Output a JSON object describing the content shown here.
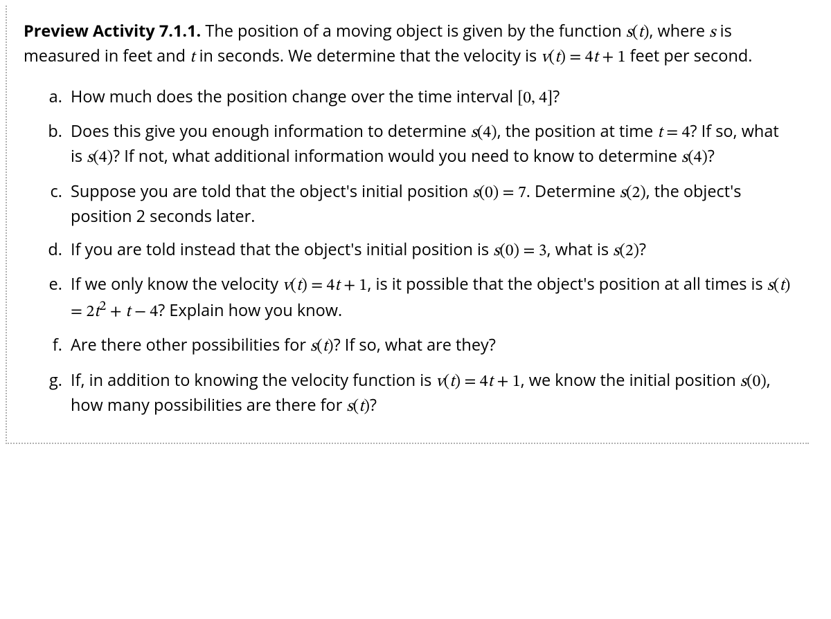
{
  "title": "Preview Activity 7.1.1.",
  "intro_parts": {
    "p1": "The position of a moving object is given by the function ",
    "m1": "s(t)",
    "p2": ", where ",
    "m2": "s",
    "p3": " is measured in feet and ",
    "m3": "t",
    "p4": " in seconds. We determine that the velocity is ",
    "m4": "v(t) = 4t + 1",
    "p5": " feet per second."
  },
  "items": {
    "a": {
      "p1": "How much does the position change over the time interval ",
      "m1": "[0, 4]",
      "p2": "?"
    },
    "b": {
      "p1": "Does this give you enough information to determine ",
      "m1": "s(4)",
      "p2": ", the position at time ",
      "m2": "t = 4",
      "p3": "? If so, what is ",
      "m3": "s(4)",
      "p4": "? If not, what additional information would you need to know to determine ",
      "m4": "s(4)",
      "p5": "?"
    },
    "c": {
      "p1": "Suppose you are told that the object's initial position ",
      "m1": "s(0) = 7",
      "p2": ". Determine ",
      "m2": "s(2)",
      "p3": ", the object's position 2 seconds later."
    },
    "d": {
      "p1": "If you are told instead that the object's initial position is ",
      "m1": "s(0) = 3",
      "p2": ", what is ",
      "m2": "s(2)",
      "p3": "?"
    },
    "e": {
      "p1": "If we only know the velocity ",
      "m1": "v(t) = 4t + 1",
      "p2": ", is it possible that the object's position at all times is ",
      "m2": "s(t) = 2t² + t − 4",
      "p3": "? Explain how you know."
    },
    "f": {
      "p1": "Are there other possibilities for ",
      "m1": "s(t)",
      "p2": "? If so, what are they?"
    },
    "g": {
      "p1": "If, in addition to knowing the velocity function is ",
      "m1": "v(t) = 4t + 1",
      "p2": ", we know the initial position ",
      "m2": "s(0)",
      "p3": ", how many possibilities are there for ",
      "m3": "s(t)",
      "p4": "?"
    }
  }
}
